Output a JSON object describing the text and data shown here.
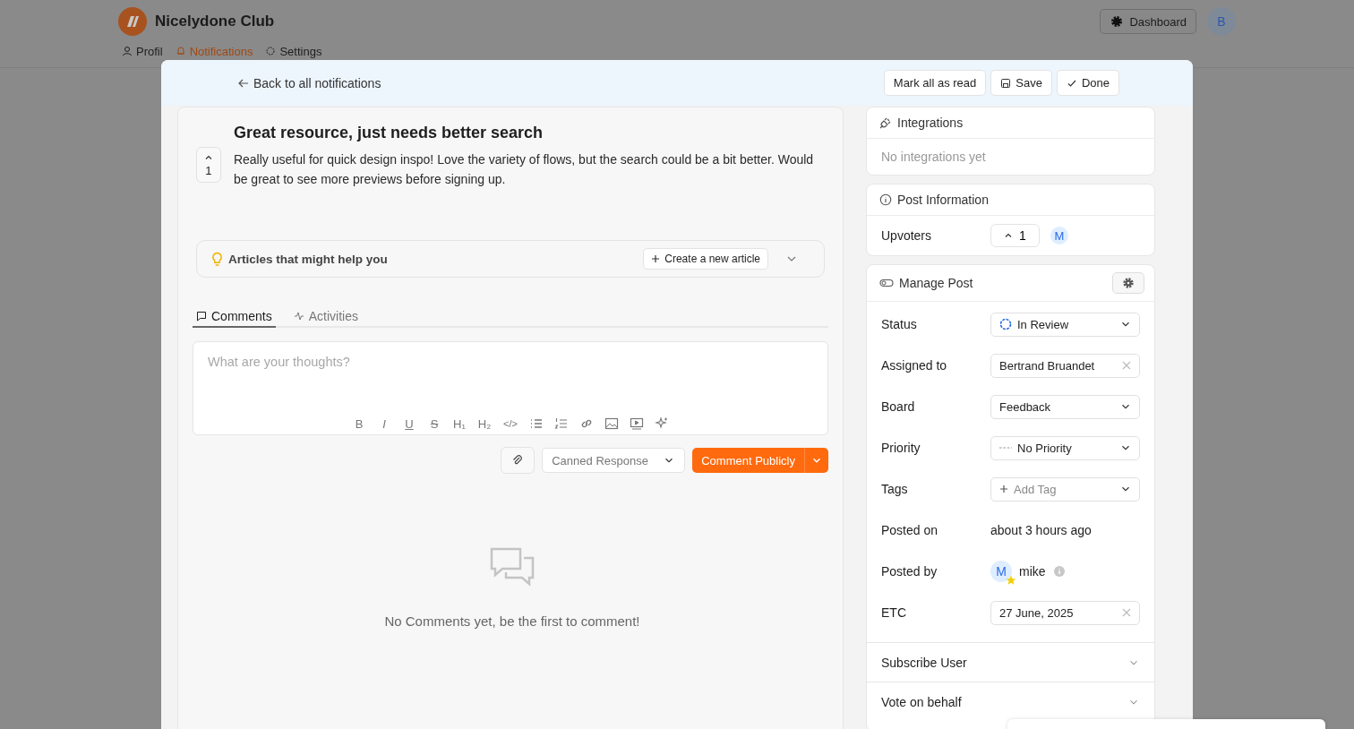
{
  "header": {
    "brand": "Nicelydone Club",
    "dashboard_button": "Dashboard",
    "avatar": "B"
  },
  "nav": [
    {
      "label": "Profil",
      "selected": false
    },
    {
      "label": "Notifications",
      "selected": true
    },
    {
      "label": "Settings",
      "selected": false
    }
  ],
  "modal": {
    "back_link": "Back to all notifications",
    "actions": [
      "Mark all as read",
      "Save",
      "Done"
    ],
    "post": {
      "title": "Great resource, just needs better search",
      "body": "Really useful for quick design inspo! Love the variety of flows, but the search could be a bit better. Would be great to see more previews before signing up.",
      "upvotes": "1"
    },
    "articles": {
      "label": "Articles that might help you",
      "create_button": "Create a new article",
      "expanded": false
    },
    "tabs": [
      {
        "label": "Comments",
        "selected": true
      },
      {
        "label": "Activities",
        "selected": false
      }
    ],
    "editor": {
      "placeholder": "What are your thoughts?",
      "toolbar": [
        {
          "kind": "bold",
          "glyph": "B"
        },
        {
          "kind": "italic",
          "glyph": "I"
        },
        {
          "kind": "underline",
          "glyph": "U"
        },
        {
          "kind": "strike",
          "glyph": "S"
        },
        {
          "kind": "heading",
          "glyph": "H₁"
        },
        {
          "kind": "heading",
          "glyph": "H₂"
        },
        {
          "kind": "code",
          "glyph": "</>"
        },
        {
          "kind": "bullets"
        },
        {
          "kind": "numbered"
        },
        {
          "kind": "link"
        },
        {
          "kind": "image"
        },
        {
          "kind": "video"
        },
        {
          "kind": "ai"
        }
      ]
    },
    "composer": {
      "canned_response": "Canned Response",
      "submit": "Comment Publicly"
    },
    "empty_state": "No Comments yet, be the first to comment!",
    "integrations": {
      "title": "Integrations",
      "empty": "No integrations yet"
    },
    "post_information": {
      "title": "Post Information",
      "upvoters_label": "Upvoters",
      "upvote_count": "1",
      "avatar": "M"
    },
    "manage_post": {
      "title": "Manage Post",
      "fields": [
        {
          "kind": "status",
          "label": "Status",
          "value": "In Review"
        },
        {
          "kind": "clearable",
          "label": "Assigned to",
          "value": "Bertrand Bruandet"
        },
        {
          "kind": "select",
          "label": "Board",
          "value": "Feedback"
        },
        {
          "kind": "priority",
          "label": "Priority",
          "value": "No Priority"
        },
        {
          "kind": "tags",
          "label": "Tags",
          "placeholder": "Add Tag"
        },
        {
          "kind": "text",
          "label": "Posted on",
          "value": "about 3 hours ago"
        },
        {
          "kind": "user",
          "label": "Posted by",
          "avatar": "M",
          "value": "mike"
        },
        {
          "kind": "clearable",
          "label": "ETC",
          "value": "27 June, 2025"
        }
      ]
    },
    "sections": [
      {
        "label": "Subscribe User",
        "expanded": false
      },
      {
        "label": "Vote on behalf",
        "expanded": false
      }
    ]
  }
}
